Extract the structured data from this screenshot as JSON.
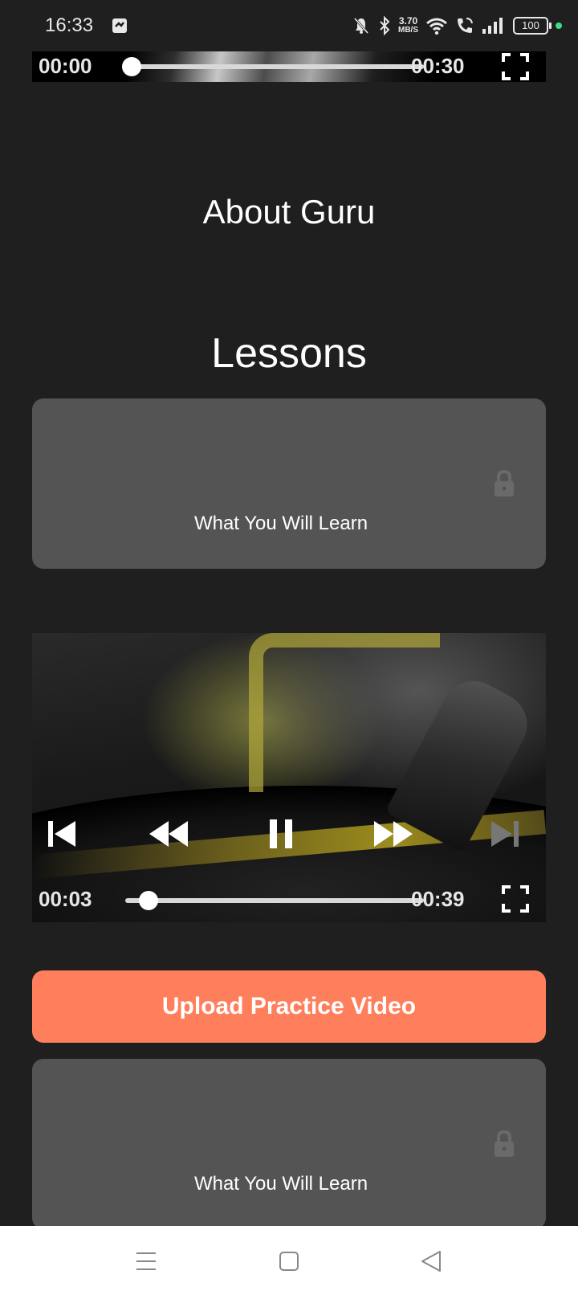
{
  "status_bar": {
    "time": "16:33",
    "net_speed_value": "3.70",
    "net_speed_unit": "MB/S",
    "battery": "100"
  },
  "top_player": {
    "elapsed": "00:00",
    "duration": "00:30",
    "progress": 0.0
  },
  "about": {
    "title": "About Guru"
  },
  "lessons": {
    "title": "Lessons"
  },
  "lesson_cards": [
    {
      "label": "What You Will Learn",
      "locked": true
    },
    {
      "label": "What You Will Learn",
      "locked": true
    }
  ],
  "video_player": {
    "elapsed": "00:03",
    "duration": "00:39",
    "progress": 0.077
  },
  "upload_button": {
    "label": "Upload Practice Video"
  },
  "colors": {
    "accent": "#ff7f5c",
    "background": "#1f1f1f",
    "card": "#545454"
  }
}
